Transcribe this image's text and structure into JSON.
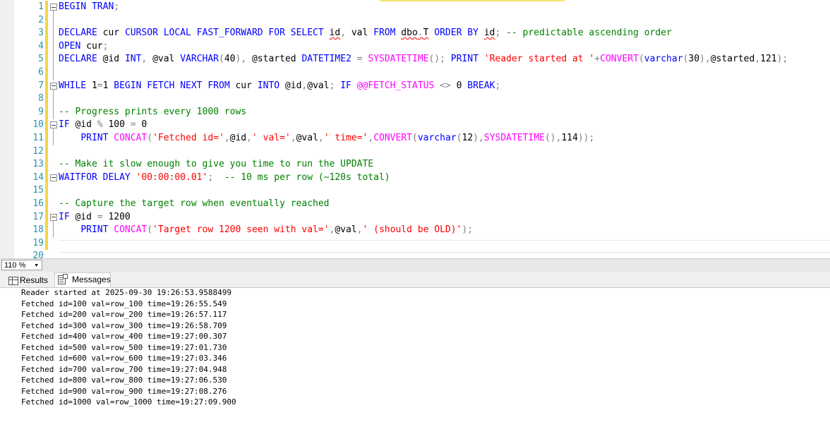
{
  "editor": {
    "line_numbers": [
      "1",
      "2",
      "3",
      "4",
      "5",
      "6",
      "7",
      "8",
      "9",
      "10",
      "11",
      "12",
      "13",
      "14",
      "15",
      "16",
      "17",
      "18",
      "19",
      "20"
    ],
    "lines": {
      "l1": [
        "BEGIN TRAN",
        ";"
      ],
      "l3": [
        "DECLARE",
        " cur ",
        "CURSOR LOCAL FAST_FORWARD FOR SELECT",
        " ",
        "id",
        ",",
        " ",
        "val",
        " ",
        "FROM",
        " ",
        "dbo",
        ".",
        "T",
        " ",
        "ORDER BY",
        " ",
        "id",
        ";",
        " ",
        "-- predictable ascending order"
      ],
      "l4": [
        "OPEN",
        " cur",
        ";"
      ],
      "l5": [
        "DECLARE",
        " @id ",
        "INT",
        ",",
        " @val ",
        "VARCHAR",
        "(",
        "40",
        ")",
        ",",
        " @started ",
        "DATETIME2",
        " ",
        "=",
        " ",
        "SYSDATETIME",
        "()",
        ";",
        " ",
        "PRINT",
        " ",
        "'Reader started at '",
        "+",
        "CONVERT",
        "(",
        "varchar",
        "(",
        "30",
        "),",
        "@started",
        ",",
        "121",
        ");"
      ],
      "l7": [
        "WHILE",
        " 1",
        "=",
        "1 ",
        "BEGIN FETCH NEXT FROM",
        " cur ",
        "INTO",
        " @id",
        ",",
        "@val",
        ";",
        " ",
        "IF",
        " ",
        "@@FETCH_STATUS",
        " ",
        "<>",
        " 0 ",
        "BREAK",
        ";"
      ],
      "l9": [
        "-- Progress prints every 1000 rows"
      ],
      "l10": [
        "IF",
        " @id ",
        "%",
        " 100 ",
        "=",
        " 0"
      ],
      "l11": [
        "    ",
        "PRINT",
        " ",
        "CONCAT",
        "(",
        "'Fetched id='",
        ",",
        "@id",
        ",",
        "' val='",
        ",",
        "@val",
        ",",
        "' time='",
        ",",
        "CONVERT",
        "(",
        "varchar",
        "(",
        "12",
        "),",
        "SYSDATETIME",
        "(),",
        "114",
        "));"
      ],
      "l13": [
        "-- Make it slow enough to give you time to run the UPDATE"
      ],
      "l14": [
        "WAITFOR DELAY",
        " ",
        "'00:00:00.01'",
        ";",
        "  ",
        "-- 10 ms per row (~120s total)"
      ],
      "l16": [
        "-- Capture the target row when eventually reached"
      ],
      "l17": [
        "IF",
        " @id ",
        "=",
        " 1200"
      ],
      "l18": [
        "    ",
        "PRINT",
        " ",
        "CONCAT",
        "(",
        "'Target row 1200 seen with val='",
        ",",
        "@val",
        ",",
        "' (should be OLD)'",
        ");"
      ]
    }
  },
  "zoom": {
    "value": "110 %"
  },
  "tabs": {
    "results": "Results",
    "messages": "Messages"
  },
  "messages": [
    "Reader started at 2025-09-30 19:26:53.9588499",
    "Fetched id=100 val=row_100 time=19:26:55.549",
    "Fetched id=200 val=row_200 time=19:26:57.117",
    "Fetched id=300 val=row_300 time=19:26:58.709",
    "Fetched id=400 val=row_400 time=19:27:00.307",
    "Fetched id=500 val=row_500 time=19:27:01.730",
    "Fetched id=600 val=row_600 time=19:27:03.346",
    "Fetched id=700 val=row_700 time=19:27:04.948",
    "Fetched id=800 val=row_800 time=19:27:06.530",
    "Fetched id=900 val=row_900 time=19:27:08.276",
    "Fetched id=1000 val=row_1000 time=19:27:09.900"
  ],
  "colors": {
    "keyword": "#0000ff",
    "string": "#ff0000",
    "comment": "#008000",
    "function": "#ff00ff",
    "operator": "#808080",
    "line_number": "#2b91af",
    "change_bar": "#f5d547"
  }
}
